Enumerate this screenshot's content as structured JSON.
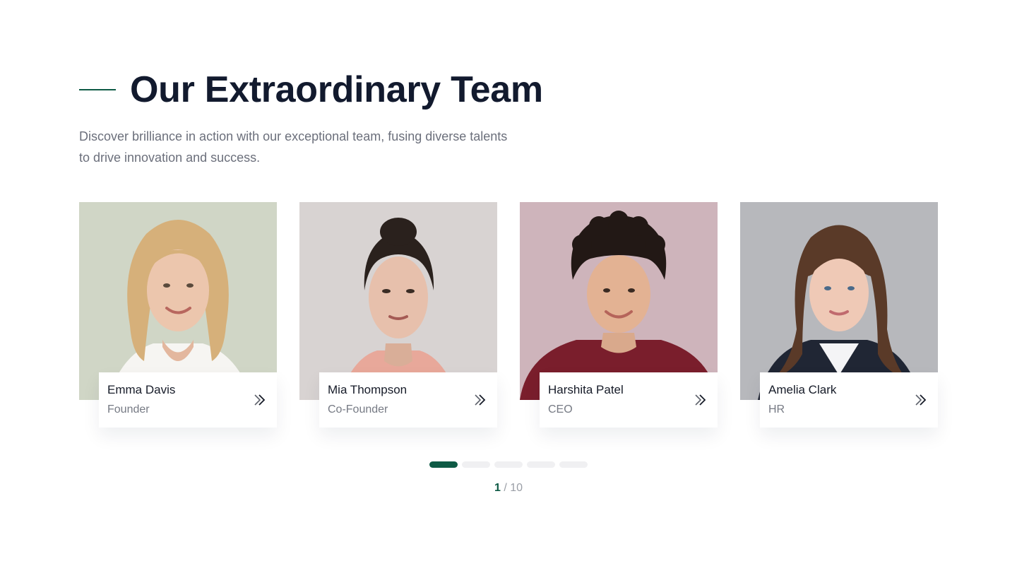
{
  "section": {
    "title": "Our Extraordinary Team",
    "subtitle": "Discover brilliance in action with our exceptional team, fusing diverse talents to drive innovation and success."
  },
  "team": [
    {
      "name": "Emma Davis",
      "role": "Founder",
      "photo_bg": "#d0d6c6",
      "icon": "double-chevron-right-icon"
    },
    {
      "name": "Mia Thompson",
      "role": "Co-Founder",
      "photo_bg": "#d8d3d2",
      "icon": "double-chevron-right-icon"
    },
    {
      "name": "Harshita Patel",
      "role": "CEO",
      "photo_bg": "#ceb4bb",
      "icon": "double-chevron-right-icon"
    },
    {
      "name": "Amelia Clark",
      "role": "HR",
      "photo_bg": "#b7b8bc",
      "icon": "double-chevron-right-icon"
    }
  ],
  "pagination": {
    "current": "1",
    "separator": "/",
    "total": "10",
    "dots_count": 5,
    "active_dot": 1
  },
  "colors": {
    "accent": "#0e5a45",
    "heading": "#121a2e",
    "body_text": "#6b6f7b"
  }
}
